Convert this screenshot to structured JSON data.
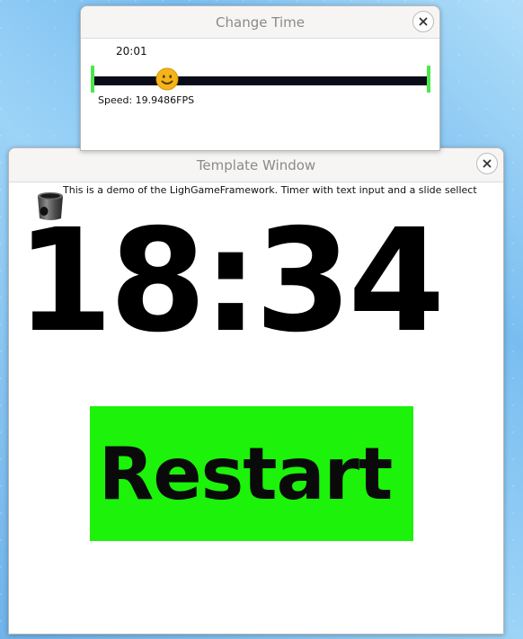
{
  "change_time_window": {
    "title": "Change Time",
    "time_value": "20:01",
    "slider": {
      "value_fraction": 0.22,
      "thumb_icon": "smiley-face-icon"
    },
    "speed_text": "Speed: 19.9486FPS"
  },
  "template_window": {
    "title": "Template Window",
    "description": "This is a demo of the LighGameFramework.  Timer with text input and a slide sellect",
    "logo_icon": "bucket-icon",
    "clock_text": "18:34",
    "restart_label": "Restart"
  },
  "colors": {
    "slider_track": "#0a0b19",
    "slider_caps": "#4be84b",
    "restart_button": "#1cf20a",
    "desktop_background": "#7cc0ef"
  }
}
